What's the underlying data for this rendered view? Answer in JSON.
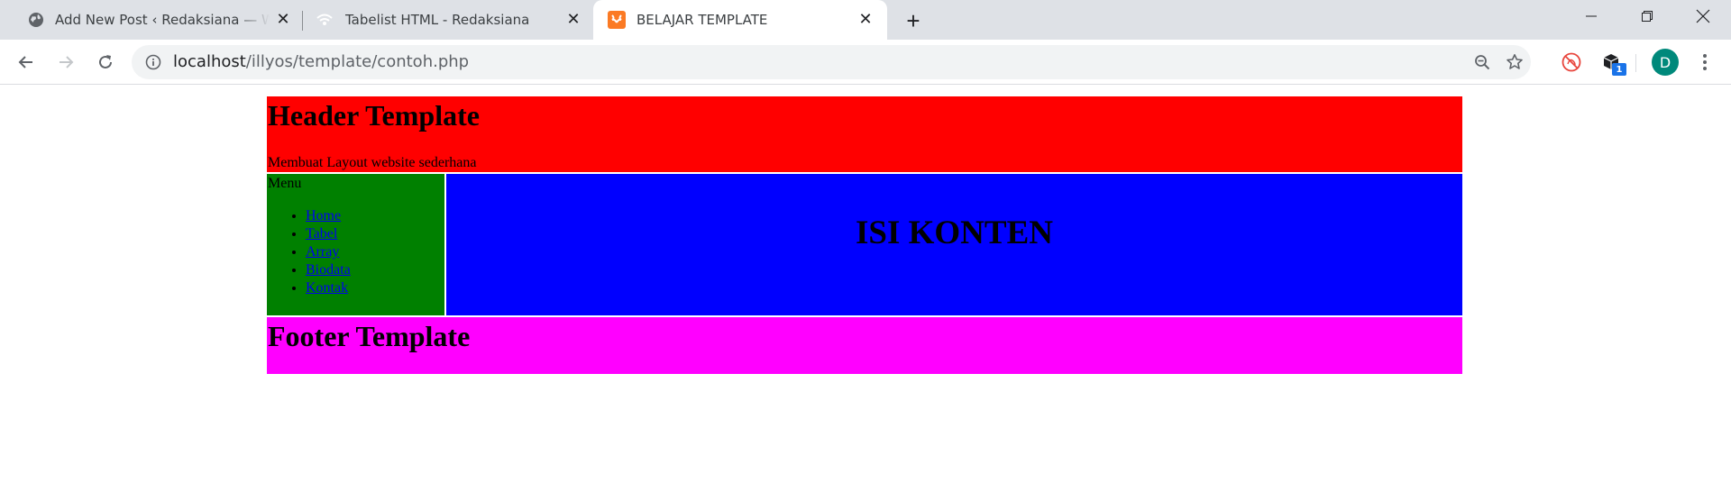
{
  "browser": {
    "tabs": [
      {
        "title": "Add New Post ‹ Redaksiana — WordPress",
        "favicon": "globe-icon",
        "active": false
      },
      {
        "title": "Tabelist HTML - Redaksiana",
        "favicon": "wifi-icon",
        "active": false
      },
      {
        "title": "BELAJAR TEMPLATE",
        "favicon": "xampp-icon",
        "active": true
      }
    ],
    "url_host": "localhost",
    "url_path": "/illyos/template/contoh.php",
    "extension_badge": "1",
    "profile_initial": "D",
    "colors": {
      "tabstrip": "#dee1e6",
      "omnibox": "#f1f3f4",
      "avatar": "#00897b",
      "badge": "#1a73e8",
      "xampp": "#fb7a24"
    }
  },
  "page": {
    "header": {
      "title": "Header Template",
      "subtitle": "Membuat Layout website sederhana"
    },
    "sidebar": {
      "title": "Menu",
      "items": [
        {
          "label": "Home"
        },
        {
          "label": "Tabel"
        },
        {
          "label": "Array"
        },
        {
          "label": "Biodata"
        },
        {
          "label": "Kontak"
        }
      ]
    },
    "content": {
      "title": "ISI KONTEN"
    },
    "footer": {
      "title": "Footer Template"
    },
    "colors": {
      "header": "#ff0000",
      "sidebar": "#008000",
      "content": "#0000ff",
      "footer": "#ff00ff",
      "link": "#0000ee"
    }
  }
}
